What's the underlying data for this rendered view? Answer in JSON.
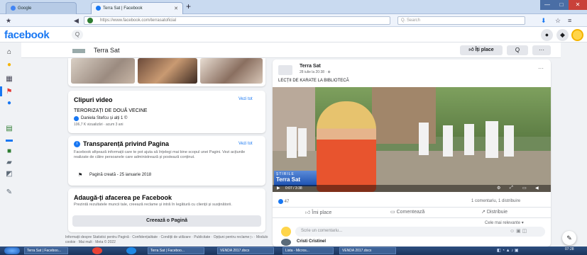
{
  "browser": {
    "tabs": [
      {
        "label": "Google"
      },
      {
        "label": "Terra Sat | Facebook"
      }
    ],
    "new_tab": "+",
    "url": "https://www.facebook.com/terrasatoficial",
    "search_placeholder": "Q. Search",
    "win": [
      "—",
      "□",
      "✕"
    ]
  },
  "fb": {
    "logo": "facebook",
    "search_icon": "Q"
  },
  "page": {
    "name": "Terra Sat",
    "like_label": "Îți place",
    "search": "Q",
    "more": "···"
  },
  "videos": {
    "title": "Clipuri video",
    "see_all": "Vezi tot",
    "video_title": "TERORIZAȚI DE DOUĂ VECINE",
    "video_author": "Daniela Stefcu și alți 1 ©",
    "video_meta": "106,7 K vizualizări · acum 3 ani"
  },
  "transparency": {
    "title": "Transparență privind Pagina",
    "see_all": "Vezi tot",
    "text": "Facebook afișează informații care te pot ajuta să înțelegi mai bine scopul unei Pagini. Vezi acțiunile realizate de către persoanele care administrează și postează conținut.",
    "created": "Pagină creată - 25 ianuarie 2018"
  },
  "business": {
    "title": "Adaugă-ți afacerea pe Facebook",
    "text": "Prezintă rezultatele muncii tale, creează reclame și intră în legătură cu clienții și susținătorii.",
    "button": "Creează o Pagină"
  },
  "footer": "Informații despre Statistici pentru Pagină · Confidențialitate · Condiții de utilizare · Publicitate · Opțiuni pentru reclame ▷ · Modulo cookie · Mai mult · Meta © 2022",
  "post": {
    "author": "Terra Sat",
    "date": "28 iulie la 20:38 · ⊕",
    "text": "LECȚII DE KARATE LA BIBLIOTECĂ",
    "more": "···",
    "reactions": "47",
    "stats": "1 comentariu, 1 distribuire",
    "like": "Îmi place",
    "comment": "Comentează",
    "share": "Distribuie",
    "relevant": "Cele mai relevante ▾",
    "comment_placeholder": "Scrie un comentariu...",
    "commenter": "Cristi Cristinel",
    "video_brand_top": "ȘTIRILE",
    "video_brand": "Terra Sat",
    "video_time": "0:07 / 3:38"
  },
  "taskbar": {
    "items": [
      "Terra Sat | Faceboo...",
      "Terra Sat | Faceboo...",
      "VENDA 2017.docx",
      "Lista - Micros...",
      "VENDA 2017.docx"
    ],
    "clock": "07:28"
  },
  "colors": {
    "accent": "#1877f2",
    "bg": "#f0f2f5"
  }
}
